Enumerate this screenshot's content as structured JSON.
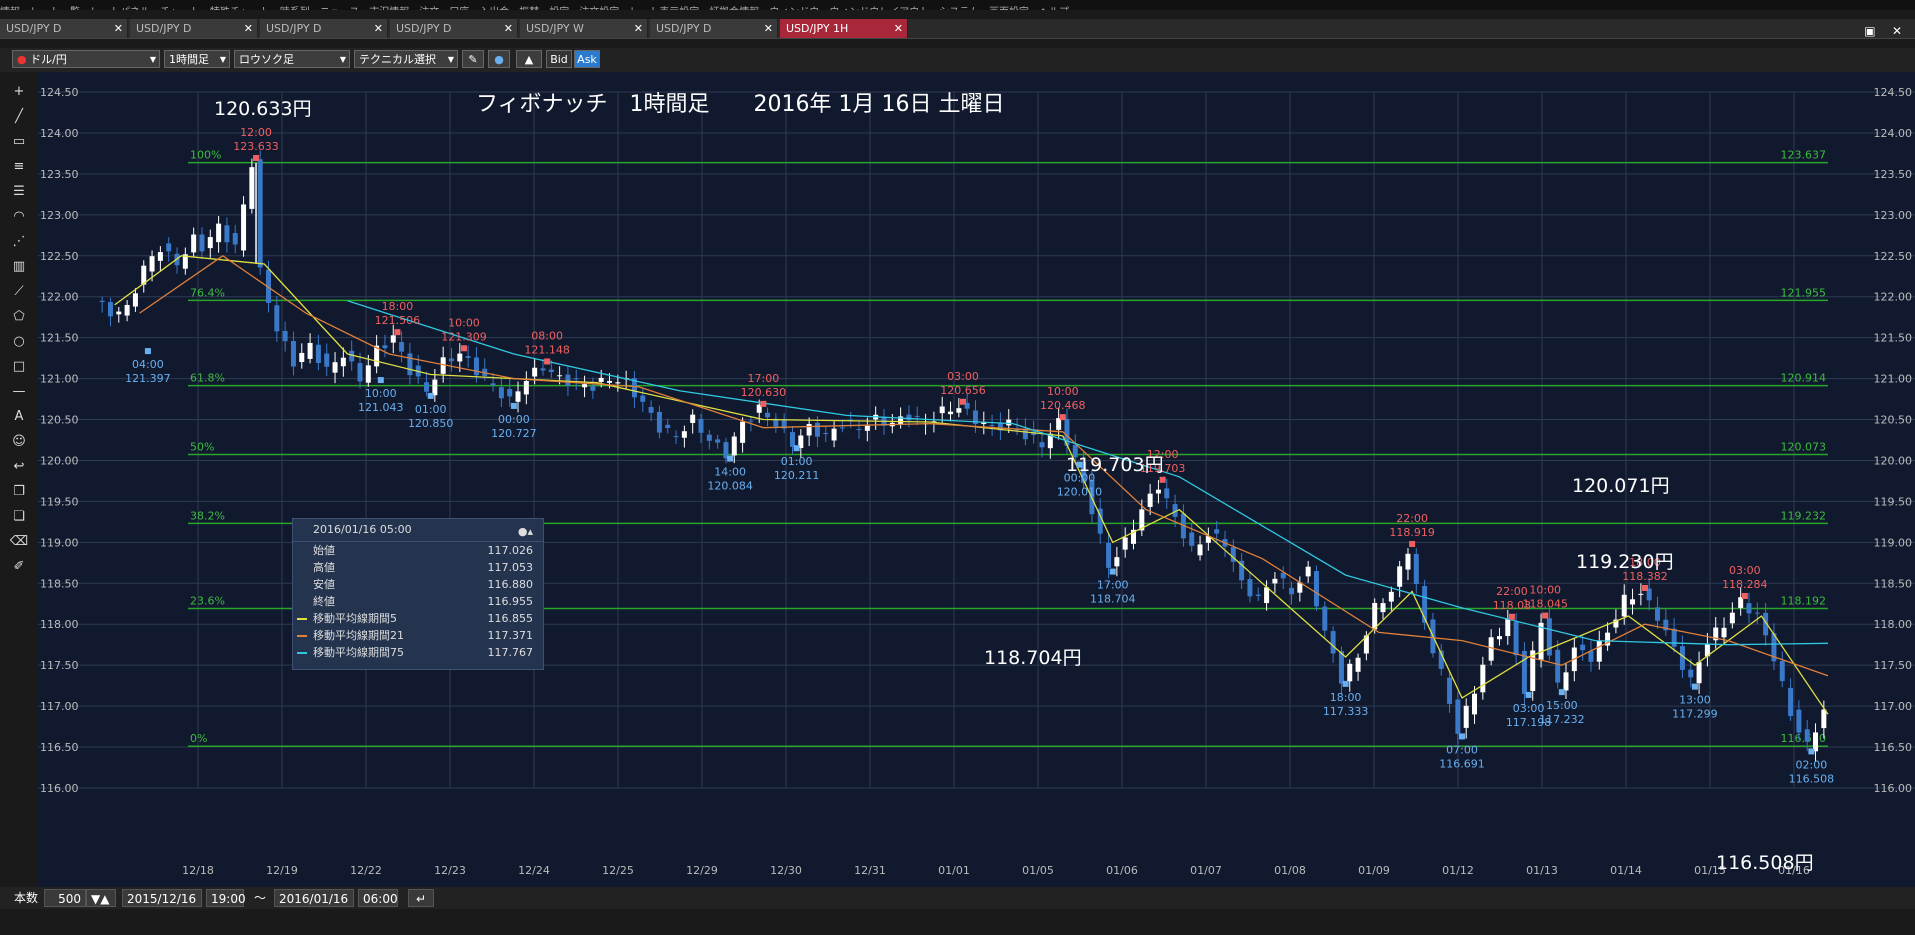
{
  "menubar": {
    "items": [
      "情報",
      "レート一覧",
      "レートパネル",
      "チャート",
      "特殊チャート",
      "時系列",
      "ニュース",
      "市況情報",
      "注文",
      "口座",
      "入出金・振替",
      "設定",
      "注文設定",
      "レート表示設定",
      "証拠金情報",
      "ウィンドウ",
      "ウィンドウレイアウト",
      "システム",
      "画面設定",
      "ヘルプ"
    ]
  },
  "tabs": [
    {
      "label": "USD/JPY D",
      "active": false
    },
    {
      "label": "USD/JPY D",
      "active": false
    },
    {
      "label": "USD/JPY D",
      "active": false
    },
    {
      "label": "USD/JPY D",
      "active": false
    },
    {
      "label": "USD/JPY W",
      "active": false
    },
    {
      "label": "USD/JPY D",
      "active": false
    },
    {
      "label": "USD/JPY 1H",
      "active": true
    }
  ],
  "tab_close_glyph": "✕",
  "toolbar": {
    "pair": "ドル/円",
    "timeframe": "1時間足",
    "charttype": "ロウソク足",
    "technical": "テクニカル選択",
    "bid": "Bid",
    "ask": "Ask"
  },
  "tools": [
    "cross-icon",
    "line-icon",
    "ruler-icon",
    "hlines-icon",
    "channel-icon",
    "fan-icon",
    "pitchfork-icon",
    "grid-icon",
    "gann-icon",
    "pentagon-icon",
    "circle-icon",
    "rect-icon",
    "hline-icon",
    "text-icon",
    "icon-icon",
    "undo-icon",
    "copy-icon",
    "paste-icon",
    "eraser-icon",
    "clear-icon"
  ],
  "annotations": {
    "title": "フィボナッチ　1時間足　　2016年 1月 16日 土曜日",
    "a1": "120.633円",
    "a2": "119.703円",
    "a3": "120.071円",
    "a4": "119.230円",
    "a5": "118.704円",
    "a6": "116.508円"
  },
  "info": {
    "datetime": "2016/01/16 05:00",
    "rows": [
      {
        "label": "始値",
        "value": "117.026",
        "swatch": ""
      },
      {
        "label": "高値",
        "value": "117.053",
        "swatch": ""
      },
      {
        "label": "安値",
        "value": "116.880",
        "swatch": ""
      },
      {
        "label": "終値",
        "value": "116.955",
        "swatch": ""
      },
      {
        "label": "移動平均線期間5",
        "value": "116.855",
        "swatch": "#e0e040"
      },
      {
        "label": "移動平均線期間21",
        "value": "117.371",
        "swatch": "#e0803a"
      },
      {
        "label": "移動平均線期間75",
        "value": "117.767",
        "swatch": "#30c8e0"
      }
    ]
  },
  "status": {
    "count_label": "本数",
    "count": "500",
    "from_date": "2015/12/16",
    "from_time": "19:00",
    "tilde": "〜",
    "to_date": "2016/01/16",
    "to_time": "06:00"
  },
  "chart_data": {
    "type": "candlestick",
    "title": "フィボナッチ　1時間足　　2016年 1月 16日 土曜日",
    "ylim": [
      116.0,
      124.5
    ],
    "yticks": [
      "124.50",
      "124.00",
      "123.50",
      "123.00",
      "122.50",
      "122.00",
      "121.50",
      "121.00",
      "120.50",
      "120.00",
      "119.50",
      "119.00",
      "118.50",
      "118.00",
      "117.50",
      "117.00",
      "116.50",
      "116.00"
    ],
    "xticks": [
      "12/18",
      "12/19",
      "12/22",
      "12/23",
      "12/24",
      "12/25",
      "12/29",
      "12/30",
      "12/31",
      "01/01",
      "01/05",
      "01/06",
      "01/07",
      "01/08",
      "01/09",
      "01/12",
      "01/13",
      "01/14",
      "01/15",
      "01/16"
    ],
    "fib_levels": [
      {
        "pct": "100%",
        "value": 123.637,
        "label": "123.637"
      },
      {
        "pct": "76.4%",
        "value": 121.955,
        "label": "121.955"
      },
      {
        "pct": "61.8%",
        "value": 120.914,
        "label": "120.914"
      },
      {
        "pct": "50%",
        "value": 120.073,
        "label": "120.073"
      },
      {
        "pct": "38.2%",
        "value": 119.232,
        "label": "119.232"
      },
      {
        "pct": "23.6%",
        "value": 118.192,
        "label": "118.192"
      },
      {
        "pct": "0%",
        "value": 116.51,
        "label": "116.510"
      }
    ],
    "price_path": [
      [
        0,
        121.95
      ],
      [
        2,
        121.8
      ],
      [
        4,
        121.85
      ],
      [
        6,
        122.35
      ],
      [
        8,
        122.6
      ],
      [
        10,
        122.4
      ],
      [
        12,
        122.7
      ],
      [
        13,
        122.6
      ],
      [
        15,
        122.85
      ],
      [
        17,
        122.6
      ],
      [
        19,
        123.633
      ],
      [
        20,
        122.3
      ],
      [
        22,
        121.6
      ],
      [
        24,
        121.2
      ],
      [
        26,
        121.4
      ],
      [
        28,
        121.1
      ],
      [
        30,
        121.3
      ],
      [
        32,
        121.0
      ],
      [
        34,
        121.35
      ],
      [
        36,
        121.506
      ],
      [
        38,
        121.1
      ],
      [
        40,
        120.85
      ],
      [
        42,
        121.2
      ],
      [
        44,
        121.309
      ],
      [
        46,
        121.1
      ],
      [
        48,
        120.9
      ],
      [
        50,
        120.727
      ],
      [
        52,
        121.0
      ],
      [
        54,
        121.148
      ],
      [
        56,
        121.0
      ],
      [
        58,
        120.95
      ],
      [
        60,
        120.9
      ],
      [
        62,
        121.0
      ],
      [
        64,
        120.95
      ],
      [
        66,
        120.7
      ],
      [
        68,
        120.4
      ],
      [
        70,
        120.3
      ],
      [
        72,
        120.5
      ],
      [
        74,
        120.25
      ],
      [
        76,
        120.084
      ],
      [
        78,
        120.45
      ],
      [
        80,
        120.63
      ],
      [
        82,
        120.45
      ],
      [
        84,
        120.211
      ],
      [
        86,
        120.4
      ],
      [
        88,
        120.3
      ],
      [
        90,
        120.45
      ],
      [
        92,
        120.4
      ],
      [
        94,
        120.5
      ],
      [
        96,
        120.45
      ],
      [
        98,
        120.55
      ],
      [
        100,
        120.45
      ],
      [
        102,
        120.6
      ],
      [
        104,
        120.656
      ],
      [
        106,
        120.5
      ],
      [
        108,
        120.4
      ],
      [
        110,
        120.45
      ],
      [
        112,
        120.3
      ],
      [
        114,
        120.2
      ],
      [
        116,
        120.468
      ],
      [
        118,
        120.01
      ],
      [
        120,
        119.4
      ],
      [
        122,
        118.704
      ],
      [
        124,
        119.0
      ],
      [
        126,
        119.4
      ],
      [
        128,
        119.703
      ],
      [
        130,
        119.3
      ],
      [
        132,
        118.9
      ],
      [
        134,
        119.1
      ],
      [
        136,
        119.0
      ],
      [
        138,
        118.5
      ],
      [
        140,
        118.3
      ],
      [
        142,
        118.6
      ],
      [
        144,
        118.4
      ],
      [
        146,
        118.65
      ],
      [
        148,
        117.9
      ],
      [
        150,
        117.333
      ],
      [
        152,
        117.6
      ],
      [
        154,
        118.2
      ],
      [
        156,
        118.4
      ],
      [
        158,
        118.919
      ],
      [
        160,
        118.0
      ],
      [
        162,
        117.4
      ],
      [
        164,
        116.691
      ],
      [
        166,
        117.2
      ],
      [
        168,
        117.8
      ],
      [
        170,
        118.03
      ],
      [
        172,
        117.198
      ],
      [
        174,
        118.045
      ],
      [
        176,
        117.232
      ],
      [
        178,
        117.7
      ],
      [
        180,
        117.6
      ],
      [
        182,
        117.9
      ],
      [
        184,
        118.3
      ],
      [
        186,
        118.382
      ],
      [
        188,
        118.1
      ],
      [
        190,
        117.7
      ],
      [
        192,
        117.299
      ],
      [
        194,
        117.8
      ],
      [
        196,
        118.0
      ],
      [
        198,
        118.284
      ],
      [
        200,
        118.1
      ],
      [
        202,
        117.6
      ],
      [
        204,
        116.9
      ],
      [
        206,
        116.508
      ],
      [
        208,
        116.95
      ]
    ],
    "ma_series": [
      {
        "name": "移動平均線期間5",
        "color": "#e0e040",
        "values": [
          [
            2,
            121.9
          ],
          [
            10,
            122.5
          ],
          [
            20,
            122.4
          ],
          [
            30,
            121.3
          ],
          [
            40,
            121.05
          ],
          [
            60,
            120.95
          ],
          [
            80,
            120.5
          ],
          [
            100,
            120.47
          ],
          [
            116,
            120.3
          ],
          [
            122,
            119.0
          ],
          [
            130,
            119.4
          ],
          [
            140,
            118.5
          ],
          [
            150,
            117.6
          ],
          [
            158,
            118.4
          ],
          [
            164,
            117.1
          ],
          [
            172,
            117.6
          ],
          [
            184,
            118.1
          ],
          [
            192,
            117.5
          ],
          [
            200,
            118.1
          ],
          [
            208,
            116.9
          ]
        ]
      },
      {
        "name": "移動平均線期間21",
        "color": "#e0803a",
        "values": [
          [
            5,
            121.8
          ],
          [
            15,
            122.5
          ],
          [
            25,
            121.8
          ],
          [
            35,
            121.3
          ],
          [
            50,
            121.0
          ],
          [
            65,
            120.9
          ],
          [
            80,
            120.4
          ],
          [
            100,
            120.45
          ],
          [
            116,
            120.35
          ],
          [
            126,
            119.4
          ],
          [
            140,
            118.8
          ],
          [
            154,
            117.9
          ],
          [
            164,
            117.8
          ],
          [
            176,
            117.5
          ],
          [
            186,
            118.0
          ],
          [
            196,
            117.8
          ],
          [
            208,
            117.37
          ]
        ]
      },
      {
        "name": "移動平均線期間75",
        "color": "#30c8e0",
        "values": [
          [
            30,
            121.95
          ],
          [
            50,
            121.3
          ],
          [
            70,
            120.85
          ],
          [
            90,
            120.55
          ],
          [
            110,
            120.45
          ],
          [
            130,
            119.8
          ],
          [
            150,
            118.6
          ],
          [
            164,
            118.2
          ],
          [
            180,
            117.8
          ],
          [
            196,
            117.75
          ],
          [
            208,
            117.767
          ]
        ]
      }
    ],
    "swing_labels": [
      {
        "t": 19,
        "v": 123.633,
        "time": "12:00",
        "price": "123.633",
        "kind": "high"
      },
      {
        "t": 6,
        "v": 121.397,
        "time": "04:00",
        "price": "121.397",
        "kind": "low"
      },
      {
        "t": 36,
        "v": 121.506,
        "time": "18:00",
        "price": "121.506",
        "kind": "high"
      },
      {
        "t": 34,
        "v": 121.043,
        "time": "10:00",
        "price": "121.043",
        "kind": "low"
      },
      {
        "t": 44,
        "v": 121.309,
        "time": "10:00",
        "price": "121.309",
        "kind": "high"
      },
      {
        "t": 40,
        "v": 120.85,
        "time": "01:00",
        "price": "120.850",
        "kind": "low"
      },
      {
        "t": 54,
        "v": 121.148,
        "time": "08:00",
        "price": "121.148",
        "kind": "high"
      },
      {
        "t": 50,
        "v": 120.727,
        "time": "00:00",
        "price": "120.727",
        "kind": "low"
      },
      {
        "t": 80,
        "v": 120.63,
        "time": "17:00",
        "price": "120.630",
        "kind": "high"
      },
      {
        "t": 76,
        "v": 120.084,
        "time": "14:00",
        "price": "120.084",
        "kind": "low"
      },
      {
        "t": 84,
        "v": 120.211,
        "time": "01:00",
        "price": "120.211",
        "kind": "low"
      },
      {
        "t": 104,
        "v": 120.656,
        "time": "03:00",
        "price": "120.656",
        "kind": "high"
      },
      {
        "t": 116,
        "v": 120.468,
        "time": "10:00",
        "price": "120.468",
        "kind": "high"
      },
      {
        "t": 118,
        "v": 120.01,
        "time": "00:00",
        "price": "120.010",
        "kind": "low"
      },
      {
        "t": 122,
        "v": 118.704,
        "time": "17:00",
        "price": "118.704",
        "kind": "low"
      },
      {
        "t": 128,
        "v": 119.703,
        "time": "12:00",
        "price": "119.703",
        "kind": "high"
      },
      {
        "t": 150,
        "v": 117.333,
        "time": "18:00",
        "price": "117.333",
        "kind": "low"
      },
      {
        "t": 158,
        "v": 118.919,
        "time": "22:00",
        "price": "118.919",
        "kind": "high"
      },
      {
        "t": 164,
        "v": 116.691,
        "time": "07:00",
        "price": "116.691",
        "kind": "low"
      },
      {
        "t": 170,
        "v": 118.03,
        "time": "22:00",
        "price": "118.03",
        "kind": "high"
      },
      {
        "t": 174,
        "v": 118.045,
        "time": "10:00",
        "price": "118.045",
        "kind": "high"
      },
      {
        "t": 172,
        "v": 117.198,
        "time": "03:00",
        "price": "117.198",
        "kind": "low"
      },
      {
        "t": 176,
        "v": 117.232,
        "time": "15:00",
        "price": "117.232",
        "kind": "low"
      },
      {
        "t": 186,
        "v": 118.382,
        "time": "18:00",
        "price": "118.382",
        "kind": "high"
      },
      {
        "t": 192,
        "v": 117.299,
        "time": "13:00",
        "price": "117.299",
        "kind": "low"
      },
      {
        "t": 198,
        "v": 118.284,
        "time": "03:00",
        "price": "118.284",
        "kind": "high"
      },
      {
        "t": 206,
        "v": 116.508,
        "time": "02:00",
        "price": "116.508",
        "kind": "low"
      }
    ],
    "colors": {
      "bg": "#10192e",
      "grid": "#2e3a52",
      "fib": "#2aa52a",
      "fibtext": "#3dbb3d",
      "up": "#ffffff",
      "down": "#3a78c8",
      "high": "#f06060",
      "low": "#6ab0f0",
      "axis": "#bbbbbb"
    }
  }
}
